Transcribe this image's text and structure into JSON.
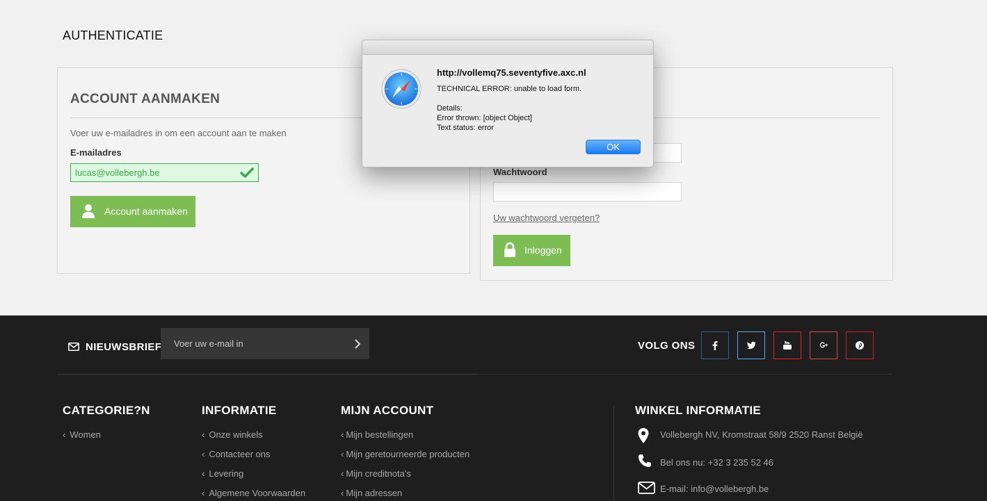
{
  "page": {
    "title": "AUTHENTICATIE"
  },
  "create_account": {
    "heading": "ACCOUNT AANMAKEN",
    "help_text": "Voer uw e-mailadres in om een account aan te maken",
    "email_label": "E-mailadres",
    "email_value": "lucas@vollebergh.be",
    "button_label": "Account aanmaken"
  },
  "login": {
    "password_label": "Wachtwoord",
    "forgot_link": "Uw wachtwoord vergeten?",
    "button_label": "Inloggen"
  },
  "dialog": {
    "host": "http://vollemq75.seventyfive.axc.nl",
    "message": "TECHNICAL ERROR: unable to load form.\n\nDetails:\nError thrown: [object Object]\nText status: error",
    "ok_label": "OK"
  },
  "footer": {
    "newsletter": {
      "label": "NIEUWSBRIEF",
      "placeholder": "Voer uw e-mail in"
    },
    "follow": {
      "label": "VOLG ONS",
      "networks": [
        {
          "name": "facebook-icon",
          "color": "#3b5998"
        },
        {
          "name": "twitter-icon",
          "color": "#55acee"
        },
        {
          "name": "youtube-icon",
          "color": "#e3252b"
        },
        {
          "name": "google-plus-icon",
          "color": "#dd4b39"
        },
        {
          "name": "pinterest-icon",
          "color": "#cb2027"
        }
      ]
    },
    "categories": {
      "title": "CATEGORIE?N",
      "items": [
        "Women"
      ]
    },
    "information": {
      "title": "INFORMATIE",
      "items": [
        "Onze winkels",
        "Contacteer ons",
        "Levering",
        "Algemene Voorwaarden"
      ]
    },
    "account": {
      "title": "MIJN ACCOUNT",
      "items": [
        "Mijn bestellingen",
        "Mijn geretourneerde producten",
        "Mijn creditnota's",
        "Mijn adressen"
      ]
    },
    "shop_info": {
      "title": "WINKEL INFORMATIE",
      "address": "Vollebergh NV, Kromstraat 58/9 2520 Ranst België",
      "phone_label": "Bel ons nu:",
      "phone": "+32 3 235 52 46",
      "email_label": "E-mail:",
      "email": "info@vollebergh.be"
    }
  },
  "colors": {
    "accent_green": "#7dbd53",
    "footer_bg": "#1e1e1e",
    "dialog_button": "#1a7cf0"
  }
}
